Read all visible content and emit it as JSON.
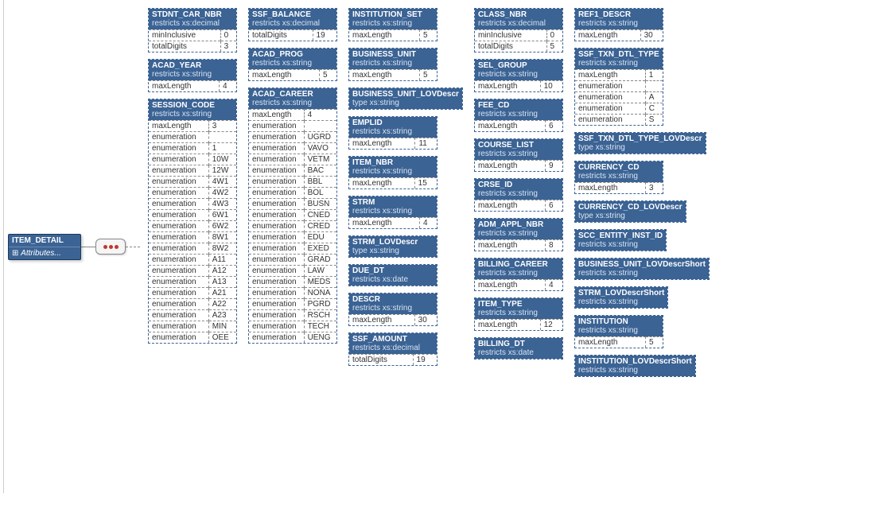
{
  "root": {
    "title": "ITEM_DETAIL",
    "attrs": "Attributes..."
  },
  "columns": [
    [
      {
        "name": "STDNT_CAR_NBR",
        "sub": "restricts xs:decimal",
        "rows": [
          [
            "minInclusive",
            "0"
          ],
          [
            "totalDigits",
            "3"
          ]
        ]
      },
      {
        "name": "ACAD_YEAR",
        "sub": "restricts xs:string",
        "rows": [
          [
            "maxLength",
            "4"
          ]
        ]
      },
      {
        "name": "SESSION_CODE",
        "sub": "restricts xs:string",
        "rows": [
          [
            "maxLength",
            "3"
          ],
          [
            "enumeration",
            ""
          ],
          [
            "enumeration",
            "1"
          ],
          [
            "enumeration",
            "10W"
          ],
          [
            "enumeration",
            "12W"
          ],
          [
            "enumeration",
            "4W1"
          ],
          [
            "enumeration",
            "4W2"
          ],
          [
            "enumeration",
            "4W3"
          ],
          [
            "enumeration",
            "6W1"
          ],
          [
            "enumeration",
            "6W2"
          ],
          [
            "enumeration",
            "8W1"
          ],
          [
            "enumeration",
            "8W2"
          ],
          [
            "enumeration",
            "A11"
          ],
          [
            "enumeration",
            "A12"
          ],
          [
            "enumeration",
            "A13"
          ],
          [
            "enumeration",
            "A21"
          ],
          [
            "enumeration",
            "A22"
          ],
          [
            "enumeration",
            "A23"
          ],
          [
            "enumeration",
            "MIN"
          ],
          [
            "enumeration",
            "OEE"
          ]
        ]
      }
    ],
    [
      {
        "name": "SSF_BALANCE",
        "sub": "restricts xs:decimal",
        "rows": [
          [
            "totalDigits",
            "19"
          ]
        ]
      },
      {
        "name": "ACAD_PROG",
        "sub": "restricts xs:string",
        "rows": [
          [
            "maxLength",
            "5"
          ]
        ]
      },
      {
        "name": "ACAD_CAREER",
        "sub": "restricts xs:string",
        "rows": [
          [
            "maxLength",
            "4"
          ],
          [
            "enumeration",
            ""
          ],
          [
            "enumeration",
            "UGRD"
          ],
          [
            "enumeration",
            "VAVO"
          ],
          [
            "enumeration",
            "VETM"
          ],
          [
            "enumeration",
            "BAC"
          ],
          [
            "enumeration",
            "BBL"
          ],
          [
            "enumeration",
            "BOL"
          ],
          [
            "enumeration",
            "BUSN"
          ],
          [
            "enumeration",
            "CNED"
          ],
          [
            "enumeration",
            "CRED"
          ],
          [
            "enumeration",
            "EDU"
          ],
          [
            "enumeration",
            "EXED"
          ],
          [
            "enumeration",
            "GRAD"
          ],
          [
            "enumeration",
            "LAW"
          ],
          [
            "enumeration",
            "MEDS"
          ],
          [
            "enumeration",
            "NONA"
          ],
          [
            "enumeration",
            "PGRD"
          ],
          [
            "enumeration",
            "RSCH"
          ],
          [
            "enumeration",
            "TECH"
          ],
          [
            "enumeration",
            "UENG"
          ]
        ]
      }
    ],
    [
      {
        "name": "INSTITUTION_SET",
        "sub": "restricts xs:string",
        "rows": [
          [
            "maxLength",
            "5"
          ]
        ]
      },
      {
        "name": "BUSINESS_UNIT",
        "sub": "restricts xs:string",
        "rows": [
          [
            "maxLength",
            "5"
          ]
        ]
      },
      {
        "name": "BUSINESS_UNIT_LOVDescr",
        "sub": "type xs:string",
        "rows": []
      },
      {
        "name": "EMPLID",
        "sub": "restricts xs:string",
        "rows": [
          [
            "maxLength",
            "11"
          ]
        ]
      },
      {
        "name": "ITEM_NBR",
        "sub": "restricts xs:string",
        "rows": [
          [
            "maxLength",
            "15"
          ]
        ]
      },
      {
        "name": "STRM",
        "sub": "restricts xs:string",
        "rows": [
          [
            "maxLength",
            "4"
          ]
        ]
      },
      {
        "name": "STRM_LOVDescr",
        "sub": "type xs:string",
        "rows": []
      },
      {
        "name": "DUE_DT",
        "sub": "restricts xs:date",
        "rows": []
      },
      {
        "name": "DESCR",
        "sub": "restricts xs:string",
        "rows": [
          [
            "maxLength",
            "30"
          ]
        ]
      },
      {
        "name": "SSF_AMOUNT",
        "sub": "restricts xs:decimal",
        "rows": [
          [
            "totalDigits",
            "19"
          ]
        ]
      }
    ],
    [
      {
        "name": "CLASS_NBR",
        "sub": "restricts xs:decimal",
        "rows": [
          [
            "minInclusive",
            "0"
          ],
          [
            "totalDigits",
            "5"
          ]
        ]
      },
      {
        "name": "SEL_GROUP",
        "sub": "restricts xs:string",
        "rows": [
          [
            "maxLength",
            "10"
          ]
        ]
      },
      {
        "name": "FEE_CD",
        "sub": "restricts xs:string",
        "rows": [
          [
            "maxLength",
            "6"
          ]
        ]
      },
      {
        "name": "COURSE_LIST",
        "sub": "restricts xs:string",
        "rows": [
          [
            "maxLength",
            "9"
          ]
        ]
      },
      {
        "name": "CRSE_ID",
        "sub": "restricts xs:string",
        "rows": [
          [
            "maxLength",
            "6"
          ]
        ]
      },
      {
        "name": "ADM_APPL_NBR",
        "sub": "restricts xs:string",
        "rows": [
          [
            "maxLength",
            "8"
          ]
        ]
      },
      {
        "name": "BILLING_CAREER",
        "sub": "restricts xs:string",
        "rows": [
          [
            "maxLength",
            "4"
          ]
        ]
      },
      {
        "name": "ITEM_TYPE",
        "sub": "restricts xs:string",
        "rows": [
          [
            "maxLength",
            "12"
          ]
        ]
      },
      {
        "name": "BILLING_DT",
        "sub": "restricts xs:date",
        "rows": []
      }
    ],
    [
      {
        "name": "REF1_DESCR",
        "sub": "restricts xs:string",
        "rows": [
          [
            "maxLength",
            "30"
          ]
        ]
      },
      {
        "name": "SSF_TXN_DTL_TYPE",
        "sub": "restricts xs:string",
        "rows": [
          [
            "maxLength",
            "1"
          ],
          [
            "enumeration",
            ""
          ],
          [
            "enumeration",
            "A"
          ],
          [
            "enumeration",
            "C"
          ],
          [
            "enumeration",
            "S"
          ]
        ]
      },
      {
        "name": "SSF_TXN_DTL_TYPE_LOVDescr",
        "sub": "type xs:string",
        "rows": []
      },
      {
        "name": "CURRENCY_CD",
        "sub": "restricts xs:string",
        "rows": [
          [
            "maxLength",
            "3"
          ]
        ]
      },
      {
        "name": "CURRENCY_CD_LOVDescr",
        "sub": "type xs:string",
        "rows": []
      },
      {
        "name": "SCC_ENTITY_INST_ID",
        "sub": "restricts xs:string",
        "rows": []
      },
      {
        "name": "BUSINESS_UNIT_LOVDescrShort",
        "sub": "restricts xs:string",
        "rows": []
      },
      {
        "name": "STRM_LOVDescrShort",
        "sub": "restricts xs:string",
        "rows": []
      },
      {
        "name": "INSTITUTION",
        "sub": "restricts xs:string",
        "rows": [
          [
            "maxLength",
            "5"
          ]
        ]
      },
      {
        "name": "INSTITUTION_LOVDescrShort",
        "sub": "restricts xs:string",
        "rows": []
      }
    ]
  ]
}
